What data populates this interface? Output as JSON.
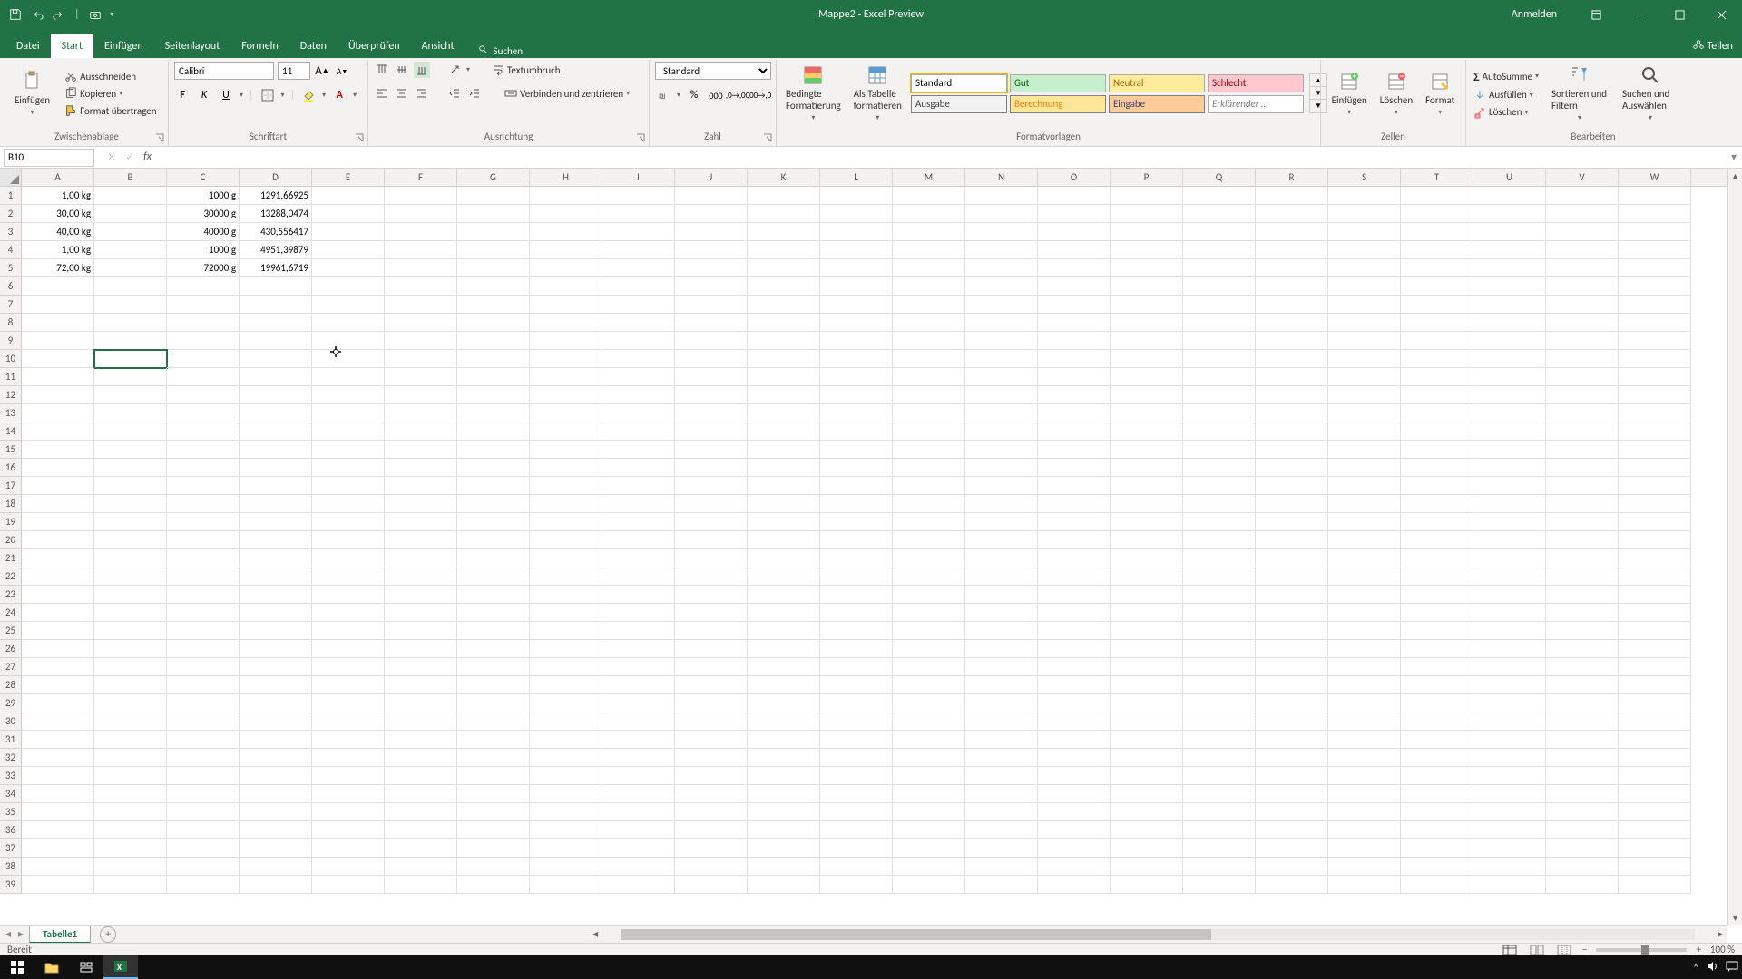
{
  "title": "Mappe2 - Excel Preview",
  "auth": {
    "signin": "Anmelden",
    "share": "Teilen"
  },
  "qat": {
    "save": "save",
    "undo": "undo",
    "redo": "redo",
    "camera": "camera"
  },
  "tabs": [
    "Datei",
    "Start",
    "Einfügen",
    "Seitenlayout",
    "Formeln",
    "Daten",
    "Überprüfen",
    "Ansicht"
  ],
  "active_tab": "Start",
  "search_placeholder": "Suchen",
  "ribbon": {
    "clipboard": {
      "paste": "Einfügen",
      "cut": "Ausschneiden",
      "copy": "Kopieren",
      "painter": "Format übertragen",
      "label": "Zwischenablage"
    },
    "font": {
      "name": "Calibri",
      "size": "11",
      "label": "Schriftart"
    },
    "alignment": {
      "wrap": "Textumbruch",
      "merge": "Verbinden und zentrieren",
      "label": "Ausrichtung"
    },
    "number": {
      "format": "Standard",
      "label": "Zahl"
    },
    "styles": {
      "cond": "Bedingte Formatierung",
      "astable": "Als Tabelle formatieren",
      "items": [
        {
          "t": "Standard",
          "bg": "#ffffff",
          "fg": "#000",
          "bd": "#aaa",
          "sel": true
        },
        {
          "t": "Gut",
          "bg": "#c6efce",
          "fg": "#006100"
        },
        {
          "t": "Neutral",
          "bg": "#ffeb9c",
          "fg": "#9c6500"
        },
        {
          "t": "Schlecht",
          "bg": "#ffc7ce",
          "fg": "#9c0006"
        },
        {
          "t": "Ausgabe",
          "bg": "#f2f2f2",
          "fg": "#3f3f3f",
          "bd": "#7f7f7f"
        },
        {
          "t": "Berechnung",
          "bg": "#ffe699",
          "fg": "#fa7d00",
          "bd": "#7f7f7f"
        },
        {
          "t": "Eingabe",
          "bg": "#ffcc99",
          "fg": "#3f3f76",
          "bd": "#7f7f7f"
        },
        {
          "t": "Erklärender …",
          "bg": "#ffffff",
          "fg": "#7f7f7f",
          "it": true
        }
      ],
      "label": "Formatvorlagen"
    },
    "cells": {
      "insert": "Einfügen",
      "delete": "Löschen",
      "format": "Format",
      "label": "Zellen"
    },
    "editing": {
      "sum": "AutoSumme",
      "fill": "Ausfüllen",
      "clear": "Löschen",
      "sort": "Sortieren und Filtern",
      "find": "Suchen und Auswählen",
      "label": "Bearbeiten"
    }
  },
  "namebox": "B10",
  "formula": "",
  "columns": [
    "A",
    "B",
    "C",
    "D",
    "E",
    "F",
    "G",
    "H",
    "I",
    "J",
    "K",
    "L",
    "M",
    "N",
    "O",
    "P",
    "Q",
    "R",
    "S",
    "T",
    "U",
    "V",
    "W"
  ],
  "row_count": 39,
  "cells": {
    "A1": "1,00 kg",
    "C1": "1000 g",
    "D1": "1291,66925",
    "A2": "30,00 kg",
    "C2": "30000 g",
    "D2": "13288,0474",
    "A3": "40,00 kg",
    "C3": "40000 g",
    "D3": "430,556417",
    "A4": "1,00 kg",
    "C4": "1000 g",
    "D4": "4951,39879",
    "A5": "72,00 kg",
    "C5": "72000 g",
    "D5": "19961,6719"
  },
  "selected": "B10",
  "cursor_at": {
    "col": "E",
    "row": 10
  },
  "sheet_tab": "Tabelle1",
  "status": "Bereit",
  "zoom": "100 %"
}
